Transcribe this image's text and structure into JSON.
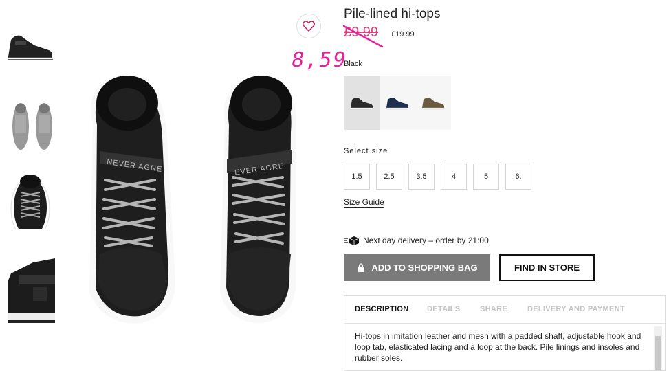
{
  "product": {
    "title": "Pile-lined hi-tops",
    "price_old": "£9.99",
    "price_compare": "£19.99",
    "handwritten_note": "8,59"
  },
  "color": {
    "label": "Black",
    "swatches": [
      {
        "name": "Black",
        "hex": "#2a2a2a",
        "selected": true
      },
      {
        "name": "Navy",
        "hex": "#1f2f4f",
        "selected": false
      },
      {
        "name": "Brown",
        "hex": "#6b5a40",
        "selected": false
      }
    ]
  },
  "sizes": {
    "label": "Select size",
    "options": [
      "1.5",
      "2.5",
      "3.5",
      "4",
      "5",
      "6."
    ],
    "guide_label": "Size Guide"
  },
  "delivery": {
    "text": "Next day delivery – order by 21:00"
  },
  "actions": {
    "add_to_bag": "ADD TO SHOPPING BAG",
    "find_in_store": "FIND IN STORE"
  },
  "tabs": {
    "items": [
      "DESCRIPTION",
      "DETAILS",
      "SHARE",
      "DELIVERY AND PAYMENT"
    ],
    "active": "DESCRIPTION",
    "description": "Hi-tops in imitation leather and mesh with a padded shaft, adjustable hook and loop tab, elasticated lacing and a loop at the back. Pile linings and insoles and rubber soles."
  },
  "icons": {
    "wishlist": "heart-icon",
    "delivery": "delivery-box-icon",
    "bag": "shopping-bag-icon"
  },
  "colors": {
    "accent_pink": "#e0407a",
    "button_grey": "#7a7a7a"
  }
}
